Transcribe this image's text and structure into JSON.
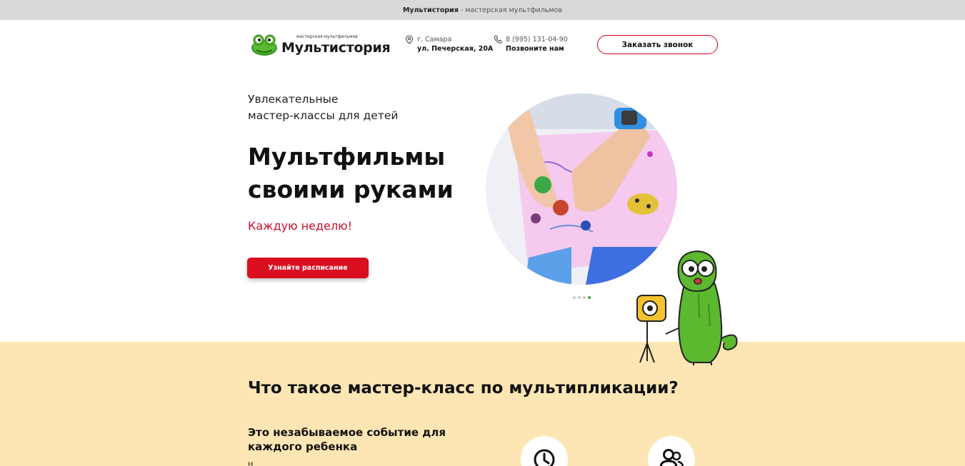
{
  "topbar": {
    "brand": "Мультистория",
    "tagline": "- мастерская мультфильмов"
  },
  "header": {
    "logo_small": "мастерская мультфильмов",
    "logo_big": "Мультистория",
    "address": {
      "city": "г. Самара",
      "street": "ул. Печерская, 20А",
      "icon": "location-pin-icon"
    },
    "phone": {
      "number": "8 (995) 131-04-90",
      "label": "Позвоните нам",
      "icon": "phone-icon"
    },
    "call_button": "Заказать звонок"
  },
  "hero": {
    "subtitle_line1": "Увлекательные",
    "subtitle_line2": "мастер-классы для детей",
    "title_line1": "Мультфильмы",
    "title_line2": "своими руками",
    "weekly": "Каждую неделю!",
    "schedule_button": "Узнайте расписание",
    "slider": {
      "count": 4,
      "active": 4
    }
  },
  "section": {
    "title": "Что такое мастер-класс по мультипликации?",
    "subtitle_line1": "Это незабываемое событие для",
    "subtitle_line2": "каждого ребенка",
    "text_start": "Н",
    "features": [
      {
        "icon": "clock-icon"
      },
      {
        "icon": "users-icon"
      }
    ]
  },
  "colors": {
    "accent": "#d90f20",
    "section_bg": "#fde6b3",
    "mascot_green": "#5cb82e",
    "topbar_bg": "#d9d9d9"
  }
}
